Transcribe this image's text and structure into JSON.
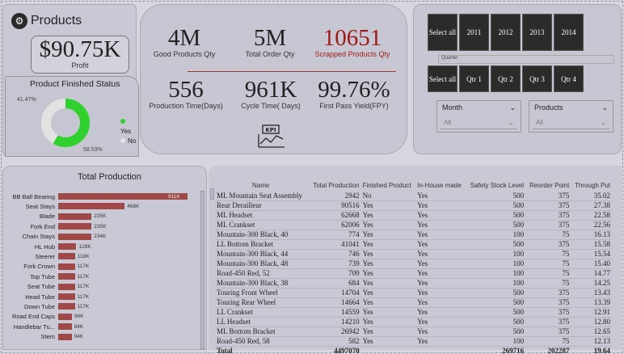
{
  "header": {
    "title": "Products",
    "logo_icon": "products-logo-icon"
  },
  "profit": {
    "value": "$90.75K",
    "label": "Profit"
  },
  "finished_status": {
    "title": "Product Finished Status",
    "yes_pct_label": "58.53%",
    "no_pct_label": "41.47%",
    "yes_value": 58.53,
    "no_value": 41.47,
    "legend_yes": "Yes",
    "legend_no": "No",
    "yes_color": "#2fd12f",
    "no_color": "#e2e2e2"
  },
  "kpis": [
    {
      "value": "4M",
      "label": "Good Products Qty",
      "color": "#1a1a1a"
    },
    {
      "value": "5M",
      "label": "Total Order Qty",
      "color": "#1a1a1a"
    },
    {
      "value": "10651",
      "label": "Scrapped Products Qty",
      "color": "#a01818"
    },
    {
      "value": "556",
      "label": "Production Time(Days)",
      "color": "#1a1a1a"
    },
    {
      "value": "961K",
      "label": "Cycle Time( Days)",
      "color": "#1a1a1a"
    },
    {
      "value": "99.76%",
      "label": "First Pass Yield(FPY)",
      "color": "#1a1a1a"
    }
  ],
  "kpi_icon": "kpi-chart-icon",
  "kpi_icon_text": "KPI",
  "year_slicer": [
    "Select all",
    "2011",
    "2012",
    "2013",
    "2014"
  ],
  "quarter_slicer": {
    "title": "Quarter",
    "items": [
      "Select all",
      "Qtr 1",
      "Qtr 2",
      "Qtr 3",
      "Qtr 4"
    ]
  },
  "month_dropdown": {
    "label": "Month",
    "value": "All"
  },
  "products_dropdown": {
    "label": "Products",
    "value": "All"
  },
  "chart_data": {
    "type": "bar",
    "title": "Total Production",
    "orientation": "horizontal",
    "categories": [
      "BB Ball Bearing",
      "Seat Stays",
      "Blade",
      "Fork End",
      "Chain Stays",
      "HL Hub",
      "Steerer",
      "Fork Crown",
      "Top Tube",
      "Seat Tube",
      "Head Tube",
      "Down Tube",
      "Road End Caps",
      "Handlebar Tu...",
      "Stem"
    ],
    "values": [
      911,
      468,
      235,
      235,
      234,
      128,
      118,
      117,
      117,
      117,
      117,
      117,
      96,
      94,
      94
    ],
    "value_labels": [
      "911K",
      "468K",
      "235K",
      "235K",
      "234K",
      "128K",
      "118K",
      "117K",
      "117K",
      "117K",
      "117K",
      "117K",
      "96K",
      "94K",
      "94K"
    ],
    "bar_color": "#a04848",
    "xlim": [
      0,
      911
    ]
  },
  "table": {
    "columns": [
      "Name",
      "Total Production",
      "Finished Product",
      "In-House made",
      "Safety Stock Level",
      "Reorder Point",
      "Through Put"
    ],
    "rows": [
      [
        "ML Mountain Seat Assembly",
        "2942",
        "No",
        "Yes",
        "500",
        "375",
        "35.02"
      ],
      [
        "Rear Derailleur",
        "90516",
        "Yes",
        "Yes",
        "500",
        "375",
        "27.38"
      ],
      [
        "ML Headset",
        "62668",
        "Yes",
        "Yes",
        "500",
        "375",
        "22.58"
      ],
      [
        "ML Crankset",
        "62006",
        "Yes",
        "Yes",
        "500",
        "375",
        "22.56"
      ],
      [
        "Mountain-300 Black, 40",
        "774",
        "Yes",
        "Yes",
        "100",
        "75",
        "16.13"
      ],
      [
        "LL Bottom Bracket",
        "41041",
        "Yes",
        "Yes",
        "500",
        "375",
        "15.58"
      ],
      [
        "Mountain-300 Black, 44",
        "746",
        "Yes",
        "Yes",
        "100",
        "75",
        "15.54"
      ],
      [
        "Mountain-300 Black, 48",
        "739",
        "Yes",
        "Yes",
        "100",
        "75",
        "15.40"
      ],
      [
        "Road-450 Red, 52",
        "709",
        "Yes",
        "Yes",
        "100",
        "75",
        "14.77"
      ],
      [
        "Mountain-300 Black, 38",
        "684",
        "Yes",
        "Yes",
        "100",
        "75",
        "14.25"
      ],
      [
        "Touring Front Wheel",
        "14704",
        "Yes",
        "Yes",
        "500",
        "375",
        "13.43"
      ],
      [
        "Touring Rear Wheel",
        "14664",
        "Yes",
        "Yes",
        "500",
        "375",
        "13.39"
      ],
      [
        "LL Crankset",
        "14559",
        "Yes",
        "Yes",
        "500",
        "375",
        "12.91"
      ],
      [
        "LL Headset",
        "14210",
        "Yes",
        "Yes",
        "500",
        "375",
        "12.80"
      ],
      [
        "ML Bottom Bracket",
        "26942",
        "Yes",
        "Yes",
        "500",
        "375",
        "12.65"
      ],
      [
        "Road-450 Red, 58",
        "582",
        "Yes",
        "Yes",
        "100",
        "75",
        "12.13"
      ]
    ],
    "total": [
      "Total",
      "4497070",
      "",
      "",
      "269716",
      "202287",
      "19.64"
    ]
  }
}
